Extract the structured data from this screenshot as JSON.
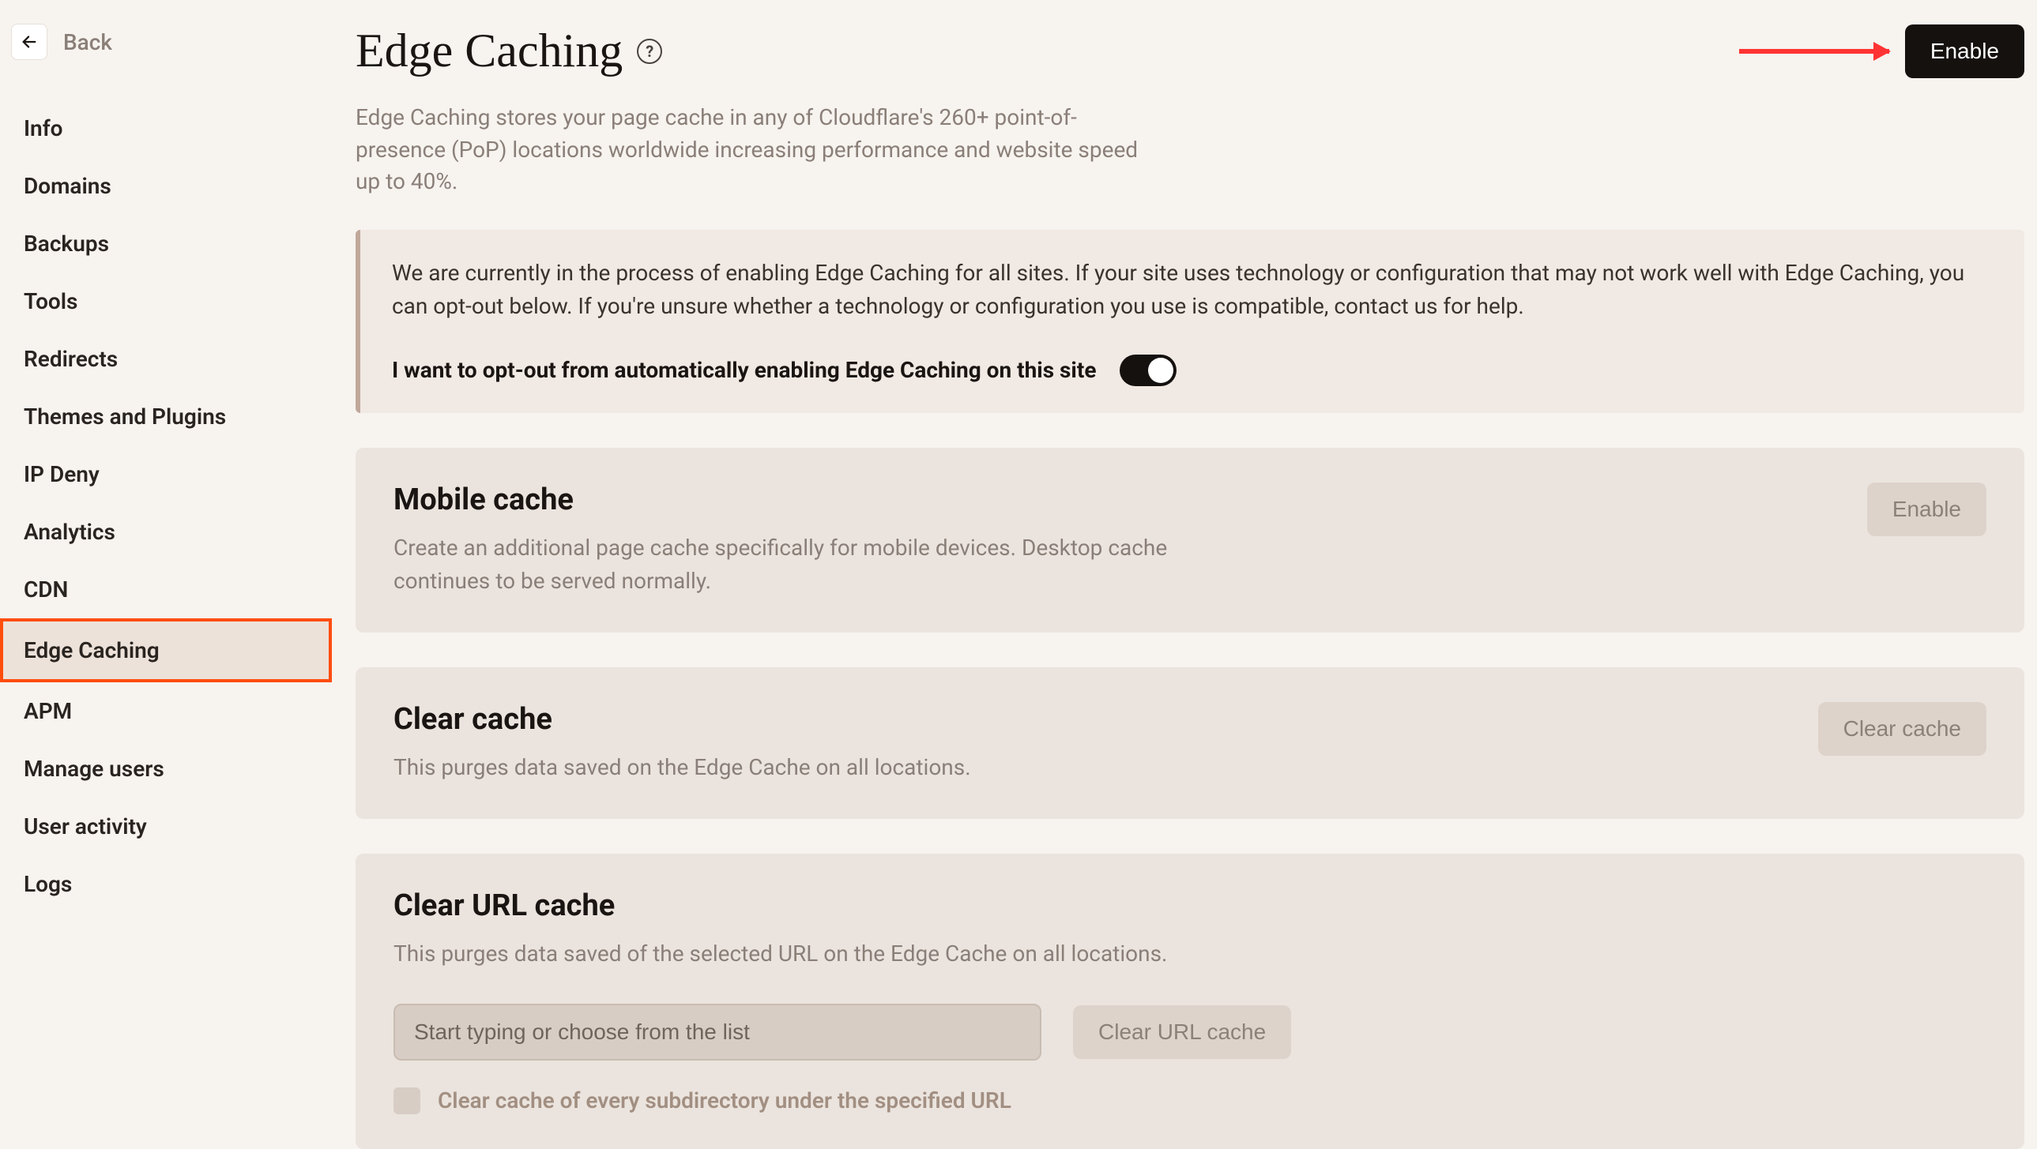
{
  "back": {
    "label": "Back"
  },
  "nav": {
    "items": [
      {
        "label": "Info"
      },
      {
        "label": "Domains"
      },
      {
        "label": "Backups"
      },
      {
        "label": "Tools"
      },
      {
        "label": "Redirects"
      },
      {
        "label": "Themes and Plugins"
      },
      {
        "label": "IP Deny"
      },
      {
        "label": "Analytics"
      },
      {
        "label": "CDN"
      },
      {
        "label": "Edge Caching"
      },
      {
        "label": "APM"
      },
      {
        "label": "Manage users"
      },
      {
        "label": "User activity"
      },
      {
        "label": "Logs"
      }
    ],
    "active_index": 9
  },
  "header": {
    "title": "Edge Caching",
    "help_glyph": "?",
    "enable_label": "Enable"
  },
  "subtitle": "Edge Caching stores your page cache in any of Cloudflare's 260+ point-of-presence (PoP) locations worldwide increasing performance and website speed up to 40%.",
  "notice": {
    "text": "We are currently in the process of enabling Edge Caching for all sites. If your site uses technology or configuration that may not work well with Edge Caching, you can opt-out below. If you're unsure whether a technology or configuration you use is compatible, contact us for help.",
    "optout_label": "I want to opt-out from automatically enabling Edge Caching on this site",
    "toggle_on": true
  },
  "mobile_cache": {
    "title": "Mobile cache",
    "desc": "Create an additional page cache specifically for mobile devices. Desktop cache continues to be served normally.",
    "button": "Enable"
  },
  "clear_cache": {
    "title": "Clear cache",
    "desc": "This purges data saved on the Edge Cache on all locations.",
    "button": "Clear cache"
  },
  "clear_url": {
    "title": "Clear URL cache",
    "desc": "This purges data saved of the selected URL on the Edge Cache on all locations.",
    "placeholder": "Start typing or choose from the list",
    "button": "Clear URL cache",
    "checkbox_label": "Clear cache of every subdirectory under the specified URL"
  },
  "annotation": {
    "arrow_color": "#ff3333",
    "highlight_color": "#ff4d0d"
  }
}
